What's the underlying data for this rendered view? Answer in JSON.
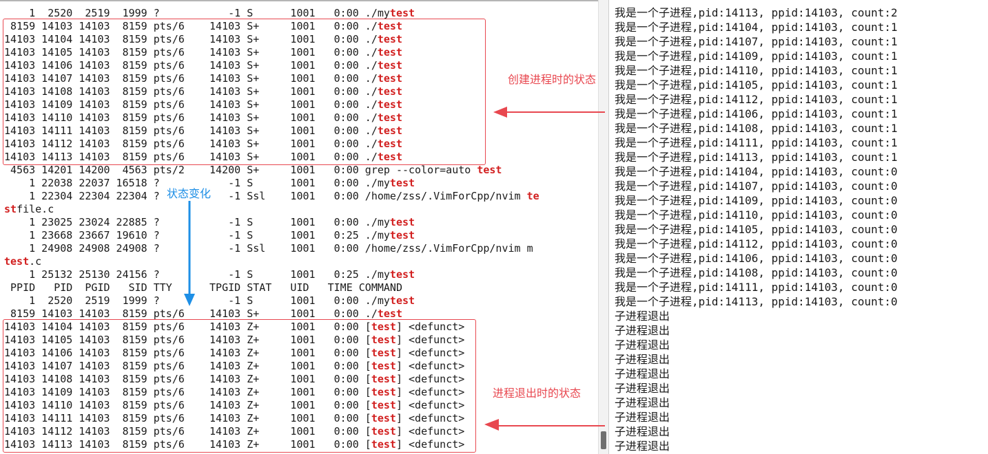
{
  "left_terminal": {
    "lines": [
      [
        "    1  2520  2519  1999 ?           -1 S      1001   0:00 ./my",
        "test",
        ""
      ],
      [
        " 8159 14103 14103  8159 pts/6    14103 S+     1001   0:00 ./",
        "test",
        ""
      ],
      [
        "14103 14104 14103  8159 pts/6    14103 S+     1001   0:00 ./",
        "test",
        ""
      ],
      [
        "14103 14105 14103  8159 pts/6    14103 S+     1001   0:00 ./",
        "test",
        ""
      ],
      [
        "14103 14106 14103  8159 pts/6    14103 S+     1001   0:00 ./",
        "test",
        ""
      ],
      [
        "14103 14107 14103  8159 pts/6    14103 S+     1001   0:00 ./",
        "test",
        ""
      ],
      [
        "14103 14108 14103  8159 pts/6    14103 S+     1001   0:00 ./",
        "test",
        ""
      ],
      [
        "14103 14109 14103  8159 pts/6    14103 S+     1001   0:00 ./",
        "test",
        ""
      ],
      [
        "14103 14110 14103  8159 pts/6    14103 S+     1001   0:00 ./",
        "test",
        ""
      ],
      [
        "14103 14111 14103  8159 pts/6    14103 S+     1001   0:00 ./",
        "test",
        ""
      ],
      [
        "14103 14112 14103  8159 pts/6    14103 S+     1001   0:00 ./",
        "test",
        ""
      ],
      [
        "14103 14113 14103  8159 pts/6    14103 S+     1001   0:00 ./",
        "test",
        ""
      ],
      [
        " 4563 14201 14200  4563 pts/2    14200 S+     1001   0:00 grep --color=auto ",
        "test",
        ""
      ],
      [
        "    1 22038 22037 16518 ?           -1 S      1001   0:00 ./my",
        "test",
        ""
      ],
      [
        "    1 22304 22304 22304 ?           -1 Ssl    1001   0:00 /home/zss/.VimForCpp/nvim ",
        "te",
        ""
      ],
      [
        "",
        "st",
        "file.c"
      ],
      [
        "    1 23025 23024 22885 ?           -1 S      1001   0:00 ./my",
        "test",
        ""
      ],
      [
        "    1 23668 23667 19610 ?           -1 S      1001   0:25 ./my",
        "test",
        ""
      ],
      [
        "    1 24908 24908 24908 ?           -1 Ssl    1001   0:00 /home/zss/.VimForCpp/nvim m",
        "",
        ""
      ],
      [
        "",
        "test",
        ".c"
      ],
      [
        "    1 25132 25130 24156 ?           -1 S      1001   0:25 ./my",
        "test",
        ""
      ],
      [
        " PPID   PID  PGID   SID TTY      TPGID STAT   UID   TIME COMMAND",
        "",
        ""
      ],
      [
        "    1  2520  2519  1999 ?           -1 S      1001   0:00 ./my",
        "test",
        ""
      ],
      [
        " 8159 14103 14103  8159 pts/6    14103 S+     1001   0:00 ./",
        "test",
        ""
      ],
      [
        "14103 14104 14103  8159 pts/6    14103 Z+     1001   0:00 [",
        "test",
        "] <defunct>"
      ],
      [
        "14103 14105 14103  8159 pts/6    14103 Z+     1001   0:00 [",
        "test",
        "] <defunct>"
      ],
      [
        "14103 14106 14103  8159 pts/6    14103 Z+     1001   0:00 [",
        "test",
        "] <defunct>"
      ],
      [
        "14103 14107 14103  8159 pts/6    14103 Z+     1001   0:00 [",
        "test",
        "] <defunct>"
      ],
      [
        "14103 14108 14103  8159 pts/6    14103 Z+     1001   0:00 [",
        "test",
        "] <defunct>"
      ],
      [
        "14103 14109 14103  8159 pts/6    14103 Z+     1001   0:00 [",
        "test",
        "] <defunct>"
      ],
      [
        "14103 14110 14103  8159 pts/6    14103 Z+     1001   0:00 [",
        "test",
        "] <defunct>"
      ],
      [
        "14103 14111 14103  8159 pts/6    14103 Z+     1001   0:00 [",
        "test",
        "] <defunct>"
      ],
      [
        "14103 14112 14103  8159 pts/6    14103 Z+     1001   0:00 [",
        "test",
        "] <defunct>"
      ],
      [
        "14103 14113 14103  8159 pts/6    14103 Z+     1001   0:00 [",
        "test",
        "] <defunct>"
      ]
    ]
  },
  "right_terminal": {
    "lines": [
      "我是一个子进程,pid:14113, ppid:14103, count:2",
      "我是一个子进程,pid:14104, ppid:14103, count:1",
      "我是一个子进程,pid:14107, ppid:14103, count:1",
      "我是一个子进程,pid:14109, ppid:14103, count:1",
      "我是一个子进程,pid:14110, ppid:14103, count:1",
      "我是一个子进程,pid:14105, ppid:14103, count:1",
      "我是一个子进程,pid:14112, ppid:14103, count:1",
      "我是一个子进程,pid:14106, ppid:14103, count:1",
      "我是一个子进程,pid:14108, ppid:14103, count:1",
      "我是一个子进程,pid:14111, ppid:14103, count:1",
      "我是一个子进程,pid:14113, ppid:14103, count:1",
      "我是一个子进程,pid:14104, ppid:14103, count:0",
      "我是一个子进程,pid:14107, ppid:14103, count:0",
      "我是一个子进程,pid:14109, ppid:14103, count:0",
      "我是一个子进程,pid:14110, ppid:14103, count:0",
      "我是一个子进程,pid:14105, ppid:14103, count:0",
      "我是一个子进程,pid:14112, ppid:14103, count:0",
      "我是一个子进程,pid:14106, ppid:14103, count:0",
      "我是一个子进程,pid:14108, ppid:14103, count:0",
      "我是一个子进程,pid:14111, ppid:14103, count:0",
      "我是一个子进程,pid:14113, ppid:14103, count:0",
      "子进程退出",
      "子进程退出",
      "子进程退出",
      "子进程退出",
      "子进程退出",
      "子进程退出",
      "子进程退出",
      "子进程退出",
      "子进程退出",
      "子进程退出"
    ]
  },
  "annotations": {
    "creating_state": "创建进程时的状态",
    "state_change": "状态变化",
    "exit_state": "进程退出时的状态",
    "red": "#e8474f",
    "blue": "#1e8fe6"
  }
}
